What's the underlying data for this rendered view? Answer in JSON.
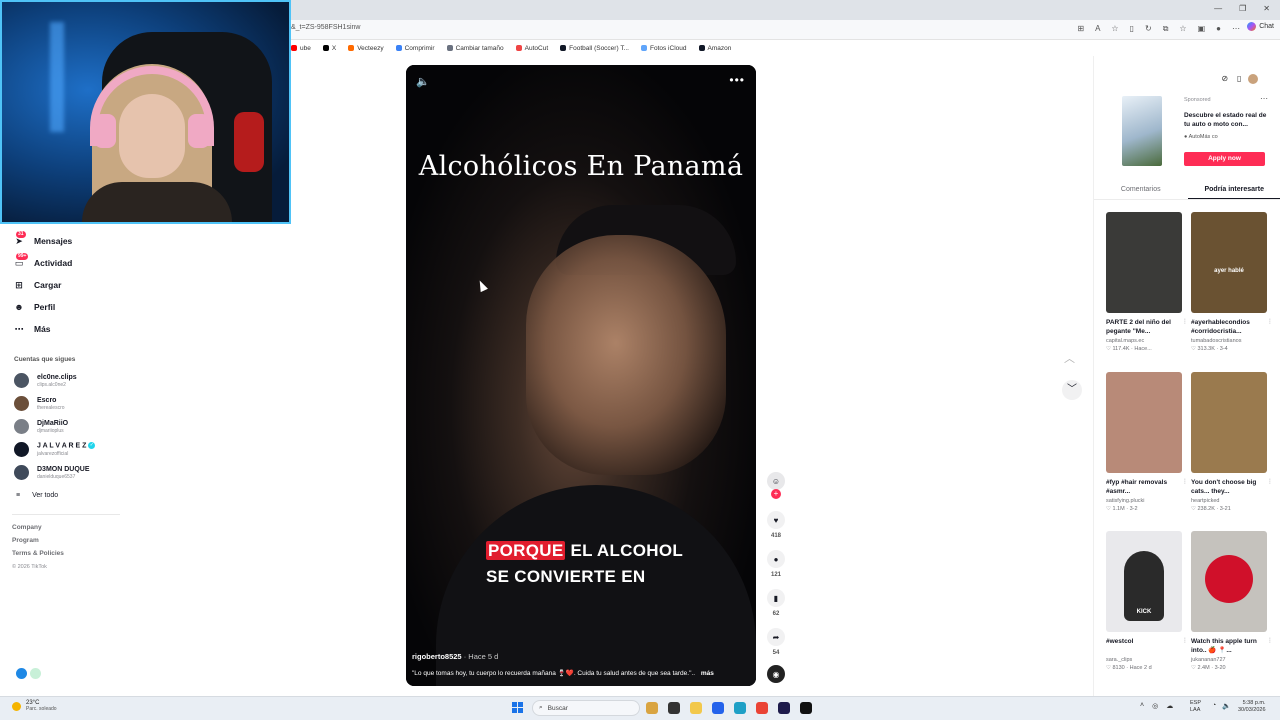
{
  "browser": {
    "url": "&_t=ZS-958FSH1sinw",
    "chat_label": "Chat",
    "bookmarks": [
      {
        "label": "ube",
        "color": "#ff0000"
      },
      {
        "label": "X",
        "color": "#000000"
      },
      {
        "label": "Vecteezy",
        "color": "#ff6a00"
      },
      {
        "label": "Comprimir",
        "color": "#3b82f6"
      },
      {
        "label": "Cambiar tamaño",
        "color": "#6b7280"
      },
      {
        "label": "AutoCut",
        "color": "#ef4444"
      },
      {
        "label": "Football (Soccer) T...",
        "color": "#111827"
      },
      {
        "label": "Fotos iCloud",
        "color": "#60a5fa"
      },
      {
        "label": "Amazon",
        "color": "#111827"
      }
    ]
  },
  "sidebar": {
    "nav": [
      {
        "label": "Mensajes",
        "icon": "paper-plane-icon",
        "badge": "31"
      },
      {
        "label": "Actividad",
        "icon": "inbox-icon",
        "badge": "99+"
      },
      {
        "label": "Cargar",
        "icon": "plus-square-icon",
        "badge": ""
      },
      {
        "label": "Perfil",
        "icon": "avatar-icon",
        "badge": ""
      },
      {
        "label": "Más",
        "icon": "more-dots-icon",
        "badge": ""
      }
    ],
    "following_title": "Cuentas que sigues",
    "following": [
      {
        "name": "elc0ne.clips",
        "handle": "clips.alc0ne2",
        "verified": false
      },
      {
        "name": "Escro",
        "handle": "therealescro",
        "verified": false
      },
      {
        "name": "DjMaRiiO",
        "handle": "djmariioplus",
        "verified": false
      },
      {
        "name": "J A L V A R E Z",
        "handle": "jalvarezofficial",
        "verified": true
      },
      {
        "name": "D3MON DUQUE",
        "handle": "danielduque6537",
        "verified": false
      }
    ],
    "see_all": "Ver todo",
    "footer": [
      "Company",
      "Program",
      "Terms & Policies"
    ],
    "copyright": "© 2026 TikTok"
  },
  "video": {
    "overlay_title": "Alcohólicos En Panamá",
    "caption_highlight": "PORQUE",
    "caption_line1_rest": " EL ALCOHOL",
    "caption_line2": "SE CONVIERTE EN",
    "author": "rigoberto8525",
    "posted": "Hace 5 d",
    "description": "\"Lo que tomas hoy, tu cuerpo lo recuerda mañana 🍷❤️. Cuida tu salud antes de que sea tarde.\"..",
    "more_label": "más"
  },
  "actions": {
    "likes": "418",
    "comments": "121",
    "saves": "62",
    "shares": "54"
  },
  "ad": {
    "sponsored": "Sponsored",
    "title": "Descubre el estado real de tu auto o moto con...",
    "brand": "AutoMás",
    "brand_suffix": "co",
    "cta": "Apply now"
  },
  "tabs": [
    "Comentarios",
    "Podría interesarte"
  ],
  "recommendations": [
    {
      "title": "PARTE 2 del niño del pegante \"Me...",
      "author": "capital.maps.ec",
      "views": "117.4K",
      "date": "Hace...",
      "thumb": "#3a3a38",
      "overlay": ""
    },
    {
      "title": "#ayerhablecondios #corridocristia...",
      "author": "tumabadoscristianos",
      "views": "313.3K",
      "date": "3-4",
      "thumb": "#6a5232",
      "overlay": "ayer hablé"
    },
    {
      "title": "#fyp #hair removals #asmr...",
      "author": "satisfying.plucki",
      "views": "1.1M",
      "date": "3-2",
      "thumb": "#b88a78",
      "overlay": ""
    },
    {
      "title": "You don't choose big cats... they...",
      "author": "heartpicked",
      "views": "238.2K",
      "date": "3-21",
      "thumb": "#9a7a4e",
      "overlay": ""
    },
    {
      "title": "#westcol",
      "author": "sara._clips",
      "views": "8130",
      "date": "Hace 2 d",
      "thumb": "#e9e9ec",
      "overlay": "KICK"
    },
    {
      "title": "Watch this apple turn into.. 🍎 📍...",
      "author": "jukananan727",
      "views": "2.4M",
      "date": "3-20",
      "thumb": "#c5c2bd",
      "overlay": ""
    }
  ],
  "taskbar": {
    "temp": "23°C",
    "weather": "Parc. soleado",
    "search_placeholder": "Buscar",
    "lang1": "ESP",
    "lang2": "LAA",
    "time": "5:38 p.m.",
    "date": "30/03/2026"
  }
}
